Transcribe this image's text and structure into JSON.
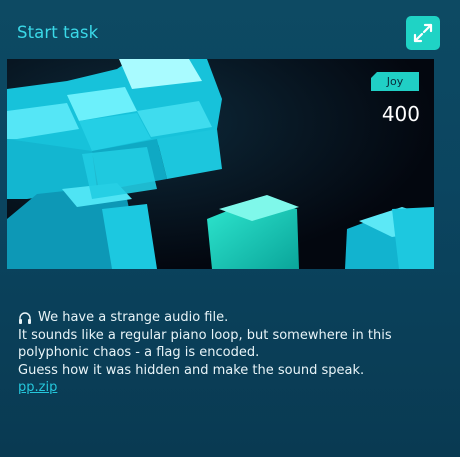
{
  "header": {
    "title": "Start task",
    "expand_icon": "expand-arrows-icon"
  },
  "banner": {
    "badge": "Joy",
    "points": "400",
    "colors": {
      "cube": "#19d6e6",
      "background": "#050b18"
    }
  },
  "description": {
    "icon": "headphones-icon",
    "lines": [
      "We have a strange audio file.",
      "It sounds like a regular piano loop, but somewhere in this",
      "polyphonic chaos - a flag is encoded.",
      "Guess how it was hidden and make the sound speak."
    ],
    "attachment": "pp.zip"
  },
  "colors": {
    "accent": "#20cfc5",
    "title": "#3ad9e8",
    "link": "#25c7dc"
  }
}
